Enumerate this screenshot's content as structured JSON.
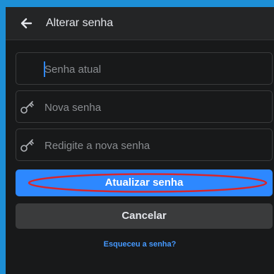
{
  "header": {
    "title": "Alterar senha",
    "back_icon": "arrow-left-icon"
  },
  "form": {
    "current_password": {
      "placeholder": "Senha atual",
      "value": ""
    },
    "new_password": {
      "placeholder": "Nova senha",
      "value": "",
      "icon": "key-icon"
    },
    "confirm_password": {
      "placeholder": "Redigite a nova senha",
      "value": "",
      "icon": "key-icon"
    }
  },
  "actions": {
    "update_label": "Atualizar senha",
    "cancel_label": "Cancelar",
    "forgot_label": "Esqueceu a senha?"
  },
  "colors": {
    "background": "#18191a",
    "header": "#242526",
    "primary": "#2d88ff",
    "secondary": "#3a3b3c",
    "highlight": "#d8262c",
    "outer_frame": "#1d8fd6"
  }
}
